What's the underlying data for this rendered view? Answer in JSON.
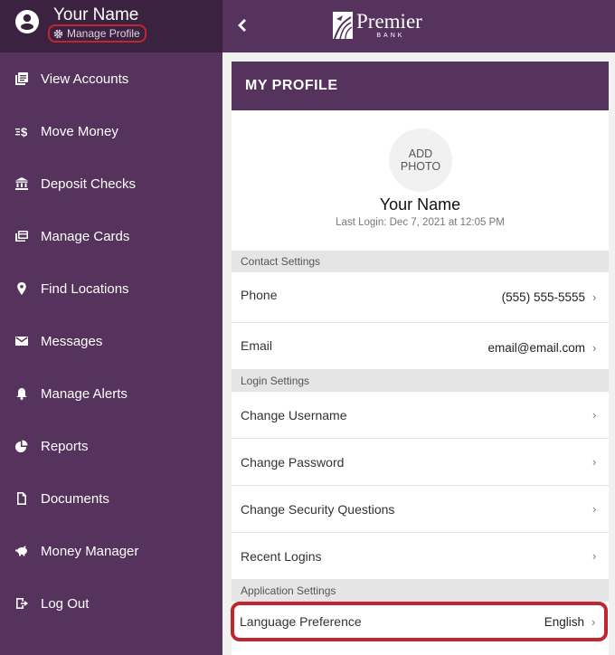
{
  "sidebar": {
    "user_name": "Your Name",
    "manage_profile_label": "Manage Profile",
    "items": [
      {
        "label": "View Accounts",
        "icon": "accounts-icon"
      },
      {
        "label": "Move Money",
        "icon": "transfer-money-icon"
      },
      {
        "label": "Deposit Checks",
        "icon": "bank-icon"
      },
      {
        "label": "Manage Cards",
        "icon": "cards-icon"
      },
      {
        "label": "Find Locations",
        "icon": "location-pin-icon"
      },
      {
        "label": "Messages",
        "icon": "envelope-icon"
      },
      {
        "label": "Manage Alerts",
        "icon": "bell-icon"
      },
      {
        "label": "Reports",
        "icon": "pie-chart-icon"
      },
      {
        "label": "Documents",
        "icon": "document-icon"
      },
      {
        "label": "Money Manager",
        "icon": "piggy-bank-icon"
      },
      {
        "label": "Log Out",
        "icon": "logout-icon"
      }
    ]
  },
  "topbar": {
    "brand_name": "Premier",
    "brand_sub": "BANK"
  },
  "profile": {
    "title": "MY PROFILE",
    "photo_line1": "ADD",
    "photo_line2": "PHOTO",
    "name": "Your Name",
    "last_login": "Last Login: Dec 7, 2021 at 12:05 PM"
  },
  "sections": {
    "contact": {
      "title": "Contact Settings",
      "phone_label": "Phone",
      "phone_value": "(555) 555-5555",
      "email_label": "Email",
      "email_value": "email@email.com"
    },
    "login": {
      "title": "Login Settings",
      "items": [
        "Change Username",
        "Change Password",
        "Change Security Questions",
        "Recent Logins"
      ]
    },
    "application": {
      "title": "Application Settings",
      "language_label": "Language Preference",
      "language_value": "English"
    }
  },
  "colors": {
    "brand_purple": "#55335c",
    "header_dark": "#3c2241",
    "highlight_red": "#c0262d"
  }
}
